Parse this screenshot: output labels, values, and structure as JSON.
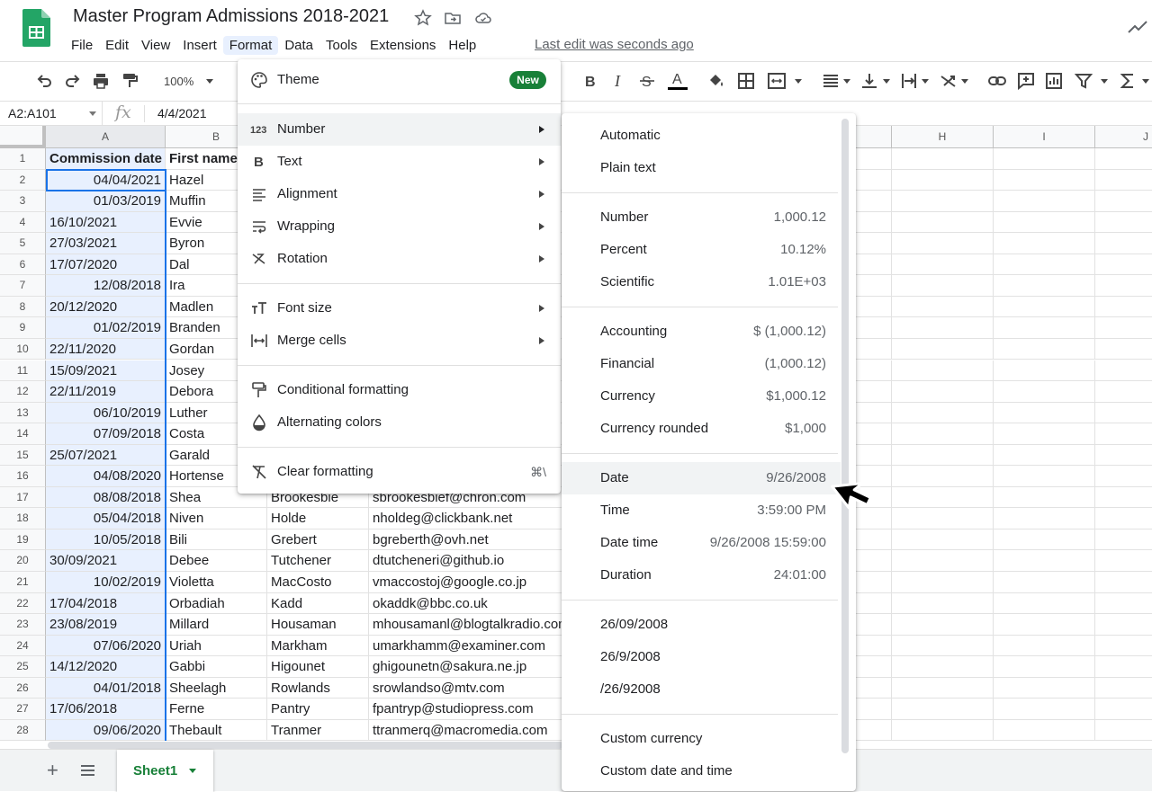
{
  "app": {
    "title": "Master Program Admissions 2018-2021",
    "last_edit": "Last edit was seconds ago",
    "menubar": [
      "File",
      "Edit",
      "View",
      "Insert",
      "Format",
      "Data",
      "Tools",
      "Extensions",
      "Help"
    ],
    "active_menu": "Format"
  },
  "toolbar": {
    "zoom": "100%"
  },
  "formula_bar": {
    "name_box": "A2:A101",
    "fx": "fx",
    "value": "4/4/2021"
  },
  "columns": [
    "A",
    "B",
    "H",
    "I",
    "J"
  ],
  "headers": {
    "a": "Commission date",
    "b": "First name"
  },
  "rows": [
    {
      "n": "2",
      "date": "04/04/2021",
      "align": "right",
      "first": "Hazel",
      "last": "",
      "email": ""
    },
    {
      "n": "3",
      "date": "01/03/2019",
      "align": "right",
      "first": "Muffin",
      "last": "",
      "email": ""
    },
    {
      "n": "4",
      "date": "16/10/2021",
      "align": "left",
      "first": "Evvie",
      "last": "",
      "email": ""
    },
    {
      "n": "5",
      "date": "27/03/2021",
      "align": "left",
      "first": "Byron",
      "last": "",
      "email": ""
    },
    {
      "n": "6",
      "date": "17/07/2020",
      "align": "left",
      "first": "Dal",
      "last": "",
      "email": ""
    },
    {
      "n": "7",
      "date": "12/08/2018",
      "align": "right",
      "first": "Ira",
      "last": "",
      "email": ""
    },
    {
      "n": "8",
      "date": "20/12/2020",
      "align": "left",
      "first": "Madlen",
      "last": "",
      "email": ""
    },
    {
      "n": "9",
      "date": "01/02/2019",
      "align": "right",
      "first": "Branden",
      "last": "",
      "email": ""
    },
    {
      "n": "10",
      "date": "22/11/2020",
      "align": "left",
      "first": "Gordan",
      "last": "",
      "email": ""
    },
    {
      "n": "11",
      "date": "15/09/2021",
      "align": "left",
      "first": "Josey",
      "last": "",
      "email": ""
    },
    {
      "n": "12",
      "date": "22/11/2019",
      "align": "left",
      "first": "Debora",
      "last": "",
      "email": ""
    },
    {
      "n": "13",
      "date": "06/10/2019",
      "align": "right",
      "first": "Luther",
      "last": "",
      "email": ""
    },
    {
      "n": "14",
      "date": "07/09/2018",
      "align": "right",
      "first": "Costa",
      "last": "",
      "email": ""
    },
    {
      "n": "15",
      "date": "25/07/2021",
      "align": "left",
      "first": "Garald",
      "last": "",
      "email": ""
    },
    {
      "n": "16",
      "date": "04/08/2020",
      "align": "right",
      "first": "Hortense",
      "last": "",
      "email": ""
    },
    {
      "n": "17",
      "date": "08/08/2018",
      "align": "right",
      "first": "Shea",
      "last": "Brookesbie",
      "email": "sbrookesbief@chron.com"
    },
    {
      "n": "18",
      "date": "05/04/2018",
      "align": "right",
      "first": "Niven",
      "last": "Holde",
      "email": "nholdeg@clickbank.net"
    },
    {
      "n": "19",
      "date": "10/05/2018",
      "align": "right",
      "first": "Bili",
      "last": "Grebert",
      "email": "bgreberth@ovh.net"
    },
    {
      "n": "20",
      "date": "30/09/2021",
      "align": "left",
      "first": "Debee",
      "last": "Tutchener",
      "email": "dtutcheneri@github.io"
    },
    {
      "n": "21",
      "date": "10/02/2019",
      "align": "right",
      "first": "Violetta",
      "last": "MacCosto",
      "email": "vmaccostoj@google.co.jp"
    },
    {
      "n": "22",
      "date": "17/04/2018",
      "align": "left",
      "first": "Orbadiah",
      "last": "Kadd",
      "email": "okaddk@bbc.co.uk"
    },
    {
      "n": "23",
      "date": "23/08/2019",
      "align": "left",
      "first": "Millard",
      "last": "Housaman",
      "email": "mhousamanl@blogtalkradio.com"
    },
    {
      "n": "24",
      "date": "07/06/2020",
      "align": "right",
      "first": "Uriah",
      "last": "Markham",
      "email": "umarkhamm@examiner.com"
    },
    {
      "n": "25",
      "date": "14/12/2020",
      "align": "left",
      "first": "Gabbi",
      "last": "Higounet",
      "email": "ghigounetn@sakura.ne.jp"
    },
    {
      "n": "26",
      "date": "04/01/2018",
      "align": "right",
      "first": "Sheelagh",
      "last": "Rowlands",
      "email": "srowlandso@mtv.com"
    },
    {
      "n": "27",
      "date": "17/06/2018",
      "align": "left",
      "first": "Ferne",
      "last": "Pantry",
      "email": "fpantryp@studiopress.com"
    },
    {
      "n": "28",
      "date": "09/06/2020",
      "align": "right",
      "first": "Thebault",
      "last": "Tranmer",
      "email": "ttranmerq@macromedia.com"
    }
  ],
  "format_menu": {
    "theme": "Theme",
    "new_badge": "New",
    "number": "Number",
    "text": "Text",
    "alignment": "Alignment",
    "wrapping": "Wrapping",
    "rotation": "Rotation",
    "font_size": "Font size",
    "merge_cells": "Merge cells",
    "conditional_formatting": "Conditional formatting",
    "alternating_colors": "Alternating colors",
    "clear_formatting": "Clear formatting",
    "clear_shortcut": "⌘\\"
  },
  "number_menu": {
    "automatic": "Automatic",
    "plain_text": "Plain text",
    "number": {
      "label": "Number",
      "value": "1,000.12"
    },
    "percent": {
      "label": "Percent",
      "value": "10.12%"
    },
    "scientific": {
      "label": "Scientific",
      "value": "1.01E+03"
    },
    "accounting": {
      "label": "Accounting",
      "value": "$ (1,000.12)"
    },
    "financial": {
      "label": "Financial",
      "value": "(1,000.12)"
    },
    "currency": {
      "label": "Currency",
      "value": "$1,000.12"
    },
    "currency_rounded": {
      "label": "Currency rounded",
      "value": "$1,000"
    },
    "date": {
      "label": "Date",
      "value": "9/26/2008"
    },
    "time": {
      "label": "Time",
      "value": "3:59:00 PM"
    },
    "date_time": {
      "label": "Date time",
      "value": "9/26/2008 15:59:00"
    },
    "duration": {
      "label": "Duration",
      "value": "24:01:00"
    },
    "fmt1": "26/09/2008",
    "fmt2": "26/9/2008",
    "fmt3": "/26/92008",
    "custom_currency": "Custom currency",
    "custom_date_time": "Custom date and time"
  },
  "sheet_tab": "Sheet1",
  "colors": {
    "accent_green": "#188038",
    "selection_blue": "#1a73e8",
    "selection_fill": "#e8f0fe"
  }
}
